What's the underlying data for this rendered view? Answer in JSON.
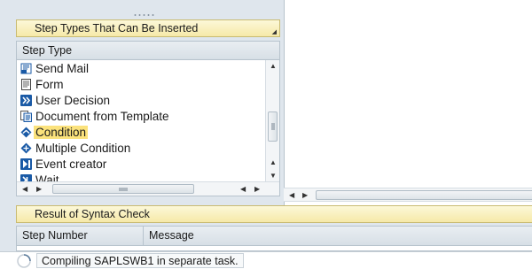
{
  "step_types_panel": {
    "title": "Step Types That Can Be Inserted",
    "column_header": "Step Type",
    "items": [
      {
        "label": "Send Mail",
        "icon": "send-mail-icon"
      },
      {
        "label": "Form",
        "icon": "form-icon"
      },
      {
        "label": "User Decision",
        "icon": "user-decision-icon"
      },
      {
        "label": "Document from Template",
        "icon": "document-template-icon"
      },
      {
        "label": "Condition",
        "icon": "condition-icon",
        "selected": true
      },
      {
        "label": "Multiple Condition",
        "icon": "multiple-condition-icon"
      },
      {
        "label": "Event creator",
        "icon": "event-creator-icon"
      },
      {
        "label": "Wait",
        "icon": "wait-icon"
      }
    ]
  },
  "syntax_check": {
    "title": "Result of Syntax Check",
    "columns": [
      "Step Number",
      "Message"
    ]
  },
  "status_bar": {
    "message": "Compiling SAPLSWB1 in separate task."
  },
  "colors": {
    "panel_bg": "#dfe6ed",
    "header_yellow": "#f6e9a8",
    "selection": "#fbe27c",
    "icon_blue": "#1a5aa6"
  }
}
